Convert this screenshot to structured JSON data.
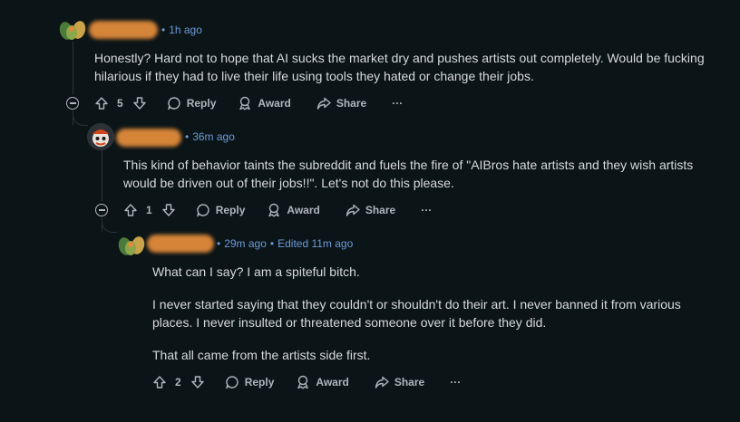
{
  "comments": [
    {
      "meta": {
        "time": "1h ago"
      },
      "body": "Honestly? Hard not to hope that AI sucks the market dry and pushes artists out completely. Would be fucking hilarious if they had to live their life using tools they hated or change their jobs.",
      "actions": {
        "votes": "5",
        "reply": "Reply",
        "award": "Award",
        "share": "Share",
        "more": "···"
      }
    },
    {
      "meta": {
        "time": "36m ago"
      },
      "body": "This kind of behavior taints the subreddit and fuels the fire of \"AIBros hate artists and they wish artists would be driven out of their jobs!!\". Let's not do this please.",
      "actions": {
        "votes": "1",
        "reply": "Reply",
        "award": "Award",
        "share": "Share",
        "more": "···"
      }
    },
    {
      "meta": {
        "time": "29m ago",
        "edited": "Edited 11m ago"
      },
      "paragraphs": [
        "What can I say? I am a spiteful bitch.",
        "I never started saying that they couldn't or shouldn't do their art. I never banned it from various places. I never insulted or threatened someone over it before they did.",
        "That all came from the artists side first."
      ],
      "actions": {
        "votes": "2",
        "reply": "Reply",
        "award": "Award",
        "share": "Share",
        "more": "···"
      }
    }
  ],
  "colors": {
    "background": "#0b1416",
    "meta_link": "#6b9bd8",
    "text": "#d7dadc",
    "action": "#aeb6bb",
    "redacted": "#e08a3a"
  },
  "icons": [
    "upvote-icon",
    "downvote-icon",
    "reply-icon",
    "award-icon",
    "share-icon",
    "more-icon",
    "collapse-icon"
  ]
}
